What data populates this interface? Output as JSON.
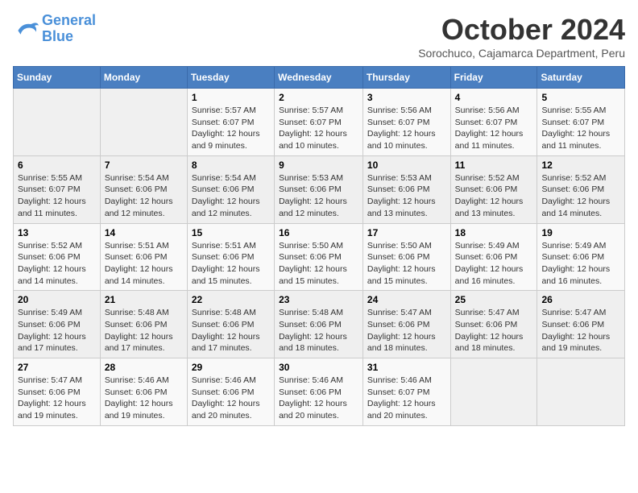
{
  "header": {
    "logo_line1": "General",
    "logo_line2": "Blue",
    "month": "October 2024",
    "location": "Sorochuco, Cajamarca Department, Peru"
  },
  "weekdays": [
    "Sunday",
    "Monday",
    "Tuesday",
    "Wednesday",
    "Thursday",
    "Friday",
    "Saturday"
  ],
  "weeks": [
    [
      {
        "day": "",
        "info": ""
      },
      {
        "day": "",
        "info": ""
      },
      {
        "day": "1",
        "info": "Sunrise: 5:57 AM\nSunset: 6:07 PM\nDaylight: 12 hours and 9 minutes."
      },
      {
        "day": "2",
        "info": "Sunrise: 5:57 AM\nSunset: 6:07 PM\nDaylight: 12 hours and 10 minutes."
      },
      {
        "day": "3",
        "info": "Sunrise: 5:56 AM\nSunset: 6:07 PM\nDaylight: 12 hours and 10 minutes."
      },
      {
        "day": "4",
        "info": "Sunrise: 5:56 AM\nSunset: 6:07 PM\nDaylight: 12 hours and 11 minutes."
      },
      {
        "day": "5",
        "info": "Sunrise: 5:55 AM\nSunset: 6:07 PM\nDaylight: 12 hours and 11 minutes."
      }
    ],
    [
      {
        "day": "6",
        "info": "Sunrise: 5:55 AM\nSunset: 6:07 PM\nDaylight: 12 hours and 11 minutes."
      },
      {
        "day": "7",
        "info": "Sunrise: 5:54 AM\nSunset: 6:06 PM\nDaylight: 12 hours and 12 minutes."
      },
      {
        "day": "8",
        "info": "Sunrise: 5:54 AM\nSunset: 6:06 PM\nDaylight: 12 hours and 12 minutes."
      },
      {
        "day": "9",
        "info": "Sunrise: 5:53 AM\nSunset: 6:06 PM\nDaylight: 12 hours and 12 minutes."
      },
      {
        "day": "10",
        "info": "Sunrise: 5:53 AM\nSunset: 6:06 PM\nDaylight: 12 hours and 13 minutes."
      },
      {
        "day": "11",
        "info": "Sunrise: 5:52 AM\nSunset: 6:06 PM\nDaylight: 12 hours and 13 minutes."
      },
      {
        "day": "12",
        "info": "Sunrise: 5:52 AM\nSunset: 6:06 PM\nDaylight: 12 hours and 14 minutes."
      }
    ],
    [
      {
        "day": "13",
        "info": "Sunrise: 5:52 AM\nSunset: 6:06 PM\nDaylight: 12 hours and 14 minutes."
      },
      {
        "day": "14",
        "info": "Sunrise: 5:51 AM\nSunset: 6:06 PM\nDaylight: 12 hours and 14 minutes."
      },
      {
        "day": "15",
        "info": "Sunrise: 5:51 AM\nSunset: 6:06 PM\nDaylight: 12 hours and 15 minutes."
      },
      {
        "day": "16",
        "info": "Sunrise: 5:50 AM\nSunset: 6:06 PM\nDaylight: 12 hours and 15 minutes."
      },
      {
        "day": "17",
        "info": "Sunrise: 5:50 AM\nSunset: 6:06 PM\nDaylight: 12 hours and 15 minutes."
      },
      {
        "day": "18",
        "info": "Sunrise: 5:49 AM\nSunset: 6:06 PM\nDaylight: 12 hours and 16 minutes."
      },
      {
        "day": "19",
        "info": "Sunrise: 5:49 AM\nSunset: 6:06 PM\nDaylight: 12 hours and 16 minutes."
      }
    ],
    [
      {
        "day": "20",
        "info": "Sunrise: 5:49 AM\nSunset: 6:06 PM\nDaylight: 12 hours and 17 minutes."
      },
      {
        "day": "21",
        "info": "Sunrise: 5:48 AM\nSunset: 6:06 PM\nDaylight: 12 hours and 17 minutes."
      },
      {
        "day": "22",
        "info": "Sunrise: 5:48 AM\nSunset: 6:06 PM\nDaylight: 12 hours and 17 minutes."
      },
      {
        "day": "23",
        "info": "Sunrise: 5:48 AM\nSunset: 6:06 PM\nDaylight: 12 hours and 18 minutes."
      },
      {
        "day": "24",
        "info": "Sunrise: 5:47 AM\nSunset: 6:06 PM\nDaylight: 12 hours and 18 minutes."
      },
      {
        "day": "25",
        "info": "Sunrise: 5:47 AM\nSunset: 6:06 PM\nDaylight: 12 hours and 18 minutes."
      },
      {
        "day": "26",
        "info": "Sunrise: 5:47 AM\nSunset: 6:06 PM\nDaylight: 12 hours and 19 minutes."
      }
    ],
    [
      {
        "day": "27",
        "info": "Sunrise: 5:47 AM\nSunset: 6:06 PM\nDaylight: 12 hours and 19 minutes."
      },
      {
        "day": "28",
        "info": "Sunrise: 5:46 AM\nSunset: 6:06 PM\nDaylight: 12 hours and 19 minutes."
      },
      {
        "day": "29",
        "info": "Sunrise: 5:46 AM\nSunset: 6:06 PM\nDaylight: 12 hours and 20 minutes."
      },
      {
        "day": "30",
        "info": "Sunrise: 5:46 AM\nSunset: 6:06 PM\nDaylight: 12 hours and 20 minutes."
      },
      {
        "day": "31",
        "info": "Sunrise: 5:46 AM\nSunset: 6:07 PM\nDaylight: 12 hours and 20 minutes."
      },
      {
        "day": "",
        "info": ""
      },
      {
        "day": "",
        "info": ""
      }
    ]
  ]
}
